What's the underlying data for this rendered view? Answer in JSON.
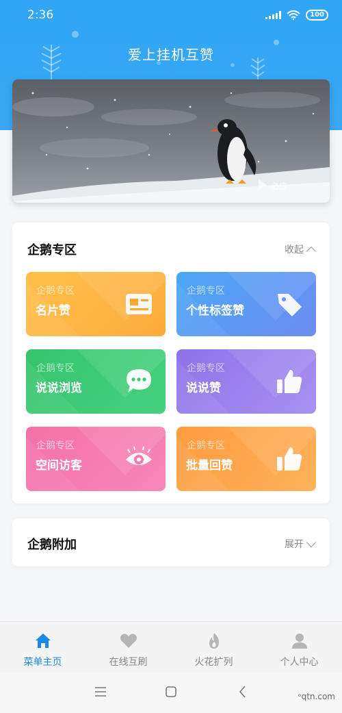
{
  "status": {
    "time": "2:36",
    "battery": "100"
  },
  "app": {
    "title": "爱上挂机互赞"
  },
  "banner": {
    "watermark": "必应"
  },
  "zone": {
    "title": "企鹅专区",
    "toggle": "收起",
    "tiles": [
      {
        "sub": "企鹅专区",
        "label": "名片赞",
        "icon": "card-icon",
        "color_a": "#ffc04a",
        "color_b": "#ffab3d"
      },
      {
        "sub": "企鹅专区",
        "label": "个性标签赞",
        "icon": "tag-icon",
        "color_a": "#4aa7f7",
        "color_b": "#6d8cf2"
      },
      {
        "sub": "企鹅专区",
        "label": "说说浏览",
        "icon": "chat-icon",
        "color_a": "#35c46b",
        "color_b": "#46d181"
      },
      {
        "sub": "企鹅专区",
        "label": "说说赞",
        "icon": "thumb-icon",
        "color_a": "#8d72e8",
        "color_b": "#a891f2"
      },
      {
        "sub": "企鹅专区",
        "label": "空间访客",
        "icon": "eye-icon",
        "color_a": "#f46fa8",
        "color_b": "#f888ba"
      },
      {
        "sub": "企鹅专区",
        "label": "批量回赞",
        "icon": "thumb-icon",
        "color_a": "#ff9b3f",
        "color_b": "#ffb25a"
      }
    ]
  },
  "extra": {
    "title": "企鹅附加",
    "toggle": "展开"
  },
  "tabs": [
    {
      "label": "菜单主页",
      "icon": "home-icon",
      "active": true
    },
    {
      "label": "在线互刷",
      "icon": "heart-icon",
      "active": false
    },
    {
      "label": "火花扩列",
      "icon": "flame-icon",
      "active": false
    },
    {
      "label": "个人中心",
      "icon": "person-icon",
      "active": false
    }
  ],
  "watermark": "ᵒqtn.com",
  "colors": {
    "header": "#2fa6f5",
    "active_tab": "#1b8ae6"
  }
}
